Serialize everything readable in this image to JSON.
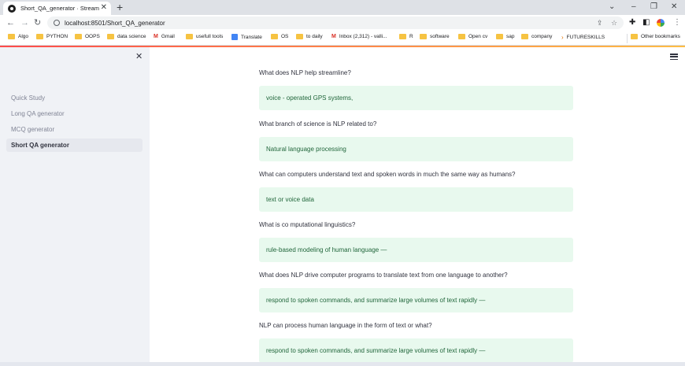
{
  "browser": {
    "tab_title": "Short_QA_generator · Streamlit",
    "tab_close": "✕",
    "new_tab": "+",
    "url": "localhost:8501/Short_QA_generator",
    "window_controls": [
      "⌄",
      "–",
      "❐",
      "✕"
    ],
    "bookmarks": [
      {
        "label": "Algo",
        "icon": "folder"
      },
      {
        "label": "PYTHON",
        "icon": "folder"
      },
      {
        "label": "OOPS",
        "icon": "folder"
      },
      {
        "label": "data science",
        "icon": "folder"
      },
      {
        "label": "Gmail",
        "icon": "gmail"
      },
      {
        "label": "usefull tools",
        "icon": "folder"
      },
      {
        "label": "Translate",
        "icon": "translate"
      },
      {
        "label": "OS",
        "icon": "folder"
      },
      {
        "label": "to daily",
        "icon": "folder"
      },
      {
        "label": "Inbox (2,312) - valli...",
        "icon": "gmail"
      },
      {
        "label": "R",
        "icon": "folder"
      },
      {
        "label": "software",
        "icon": "folder"
      },
      {
        "label": "Open cv",
        "icon": "folder"
      },
      {
        "label": "sap",
        "icon": "folder"
      },
      {
        "label": "company",
        "icon": "folder"
      },
      {
        "label": "FUTURESKILLS",
        "icon": "arrow"
      }
    ],
    "other_bookmarks": "Other bookmarks"
  },
  "sidebar": {
    "close_glyph": "✕",
    "items": [
      {
        "label": "Quick Study",
        "active": false
      },
      {
        "label": "Long QA generator",
        "active": false
      },
      {
        "label": "MCQ generator",
        "active": false
      },
      {
        "label": "Short QA generator",
        "active": true
      }
    ]
  },
  "main": {
    "qa": [
      {
        "question": "What does NLP help streamline?",
        "answer": "voice - operated GPS systems,"
      },
      {
        "question": "What branch of science is NLP related to?",
        "answer": "Natural language processing"
      },
      {
        "question": "What can computers understand text and spoken words in much the same way as humans?",
        "answer": "text or voice data"
      },
      {
        "question": "What is co mputational linguistics?",
        "answer": "rule-based modeling of human language —"
      },
      {
        "question": "What does NLP drive computer programs to translate text from one language to another?",
        "answer": "respond to spoken commands, and summarize large volumes of text rapidly —"
      },
      {
        "question": "NLP can process human language in the form of text or what?",
        "answer": "respond to spoken commands, and summarize large volumes of text rapidly —"
      }
    ]
  },
  "colors": {
    "answer_bg": "#e8f9ee",
    "answer_text": "#21663b",
    "sidebar_bg": "#f0f2f6",
    "accent": "#ff4b4b"
  }
}
